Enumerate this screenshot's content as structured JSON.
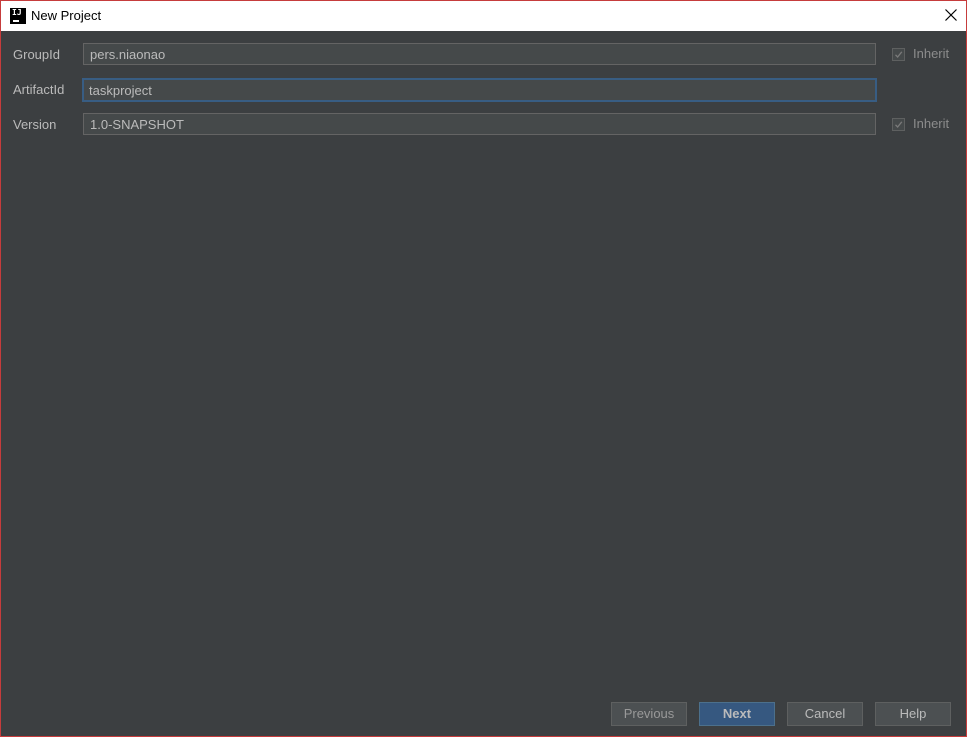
{
  "window": {
    "title": "New Project",
    "app_icon": "intellij-icon",
    "close_icon": "close-icon"
  },
  "form": {
    "group_id": {
      "label": "GroupId",
      "value": "pers.niaonao",
      "inherit_label": "Inherit",
      "inherit_checked": true
    },
    "artifact_id": {
      "label": "ArtifactId",
      "value": "taskproject"
    },
    "version": {
      "label": "Version",
      "value": "1.0-SNAPSHOT",
      "inherit_label": "Inherit",
      "inherit_checked": true
    }
  },
  "buttons": {
    "previous": "Previous",
    "next": "Next",
    "cancel": "Cancel",
    "help": "Help"
  },
  "colors": {
    "background": "#3c3f41",
    "field_bg": "#45494a",
    "focus_border": "#385d83",
    "default_button": "#365880",
    "window_border": "#c63c3c"
  }
}
